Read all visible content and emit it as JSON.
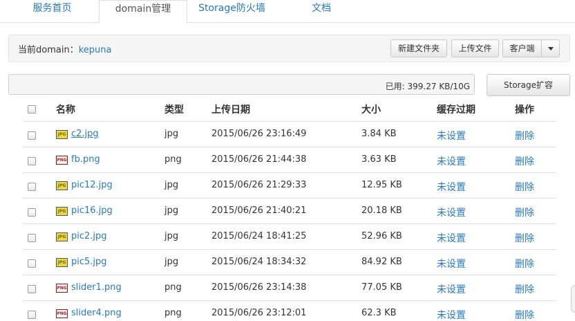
{
  "tabs": [
    {
      "label": "服务首页"
    },
    {
      "label": "domain管理"
    },
    {
      "label": "Storage防火墙"
    },
    {
      "label": "文档"
    }
  ],
  "domain_bar": {
    "prefix": "当前domain：",
    "domain": "kepuna",
    "new_folder_label": "新建文件夹",
    "upload_label": "上传文件",
    "client_label": "客户端"
  },
  "usage": {
    "text": "已用: 399.27 KB/10G",
    "fraction": 0.0,
    "expand_label": "Storage扩容"
  },
  "table": {
    "headers": {
      "name": "名称",
      "type": "类型",
      "date": "上传日期",
      "size": "大小",
      "cache": "缓存过期",
      "action": "操作"
    },
    "rows": [
      {
        "name": "c2.jpg",
        "icon": "JPG",
        "type": "jpg",
        "date": "2015/06/26 23:16:49",
        "size": "3.84 KB",
        "cache": "未设置",
        "action": "删除"
      },
      {
        "name": "fb.png",
        "icon": "PNG",
        "type": "png",
        "date": "2015/06/26 21:44:38",
        "size": "3.63 KB",
        "cache": "未设置",
        "action": "删除"
      },
      {
        "name": "pic12.jpg",
        "icon": "JPG",
        "type": "jpg",
        "date": "2015/06/26 21:29:33",
        "size": "12.95 KB",
        "cache": "未设置",
        "action": "删除"
      },
      {
        "name": "pic16.jpg",
        "icon": "JPG",
        "type": "jpg",
        "date": "2015/06/26 21:40:21",
        "size": "20.18 KB",
        "cache": "未设置",
        "action": "删除"
      },
      {
        "name": "pic2.jpg",
        "icon": "JPG",
        "type": "jpg",
        "date": "2015/06/24 18:41:25",
        "size": "52.96 KB",
        "cache": "未设置",
        "action": "删除"
      },
      {
        "name": "pic5.jpg",
        "icon": "JPG",
        "type": "jpg",
        "date": "2015/06/24 18:34:32",
        "size": "84.92 KB",
        "cache": "未设置",
        "action": "删除"
      },
      {
        "name": "slider1.png",
        "icon": "PNG",
        "type": "png",
        "date": "2015/06/26 23:14:38",
        "size": "77.05 KB",
        "cache": "未设置",
        "action": "删除"
      },
      {
        "name": "slider4.png",
        "icon": "PNG",
        "type": "png",
        "date": "2015/06/26 23:12:01",
        "size": "62.3 KB",
        "cache": "未设置",
        "action": "删除"
      }
    ]
  }
}
